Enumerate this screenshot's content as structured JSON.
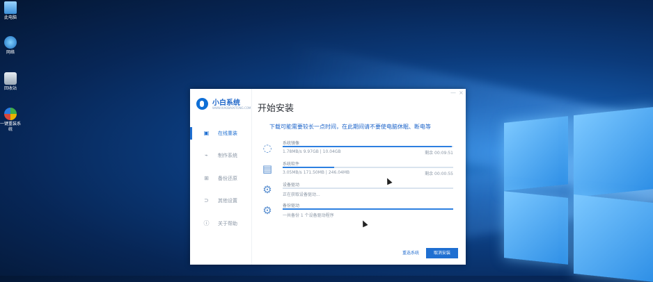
{
  "desktop_icons": [
    {
      "label": "此电脑",
      "icon": "computer-icon"
    },
    {
      "label": "网络",
      "icon": "network-icon"
    },
    {
      "label": "回收站",
      "icon": "recycle-bin-icon"
    },
    {
      "label": "一键重装系统",
      "icon": "reinstall-app-icon"
    }
  ],
  "window": {
    "brand_name": "小白系统",
    "brand_sub": "WWW.XIAOBAIXITONG.COM",
    "title": "开始安装",
    "notice": "下载可能需要较长一点时间，在此期间请不要使电脑休眠、断电等",
    "controls": {
      "minimize": "—",
      "close": "×"
    }
  },
  "sidebar": {
    "items": [
      {
        "label": "在线重装",
        "icon": "monitor-icon",
        "active": true
      },
      {
        "label": "制作系统",
        "icon": "usb-icon",
        "active": false
      },
      {
        "label": "备份还原",
        "icon": "backup-icon",
        "active": false
      },
      {
        "label": "其他设置",
        "icon": "settings-icon",
        "active": false
      },
      {
        "label": "关于帮助",
        "icon": "info-icon",
        "active": false
      }
    ]
  },
  "tasks": [
    {
      "name": "系统镜像",
      "detail": "1.78MB/s 9.97GB | 10.04GB",
      "remaining": "剩余 00:09:51",
      "progress": 0.99,
      "icon": "download-icon"
    },
    {
      "name": "系统软件",
      "detail": "3.05MB/s 171.50MB | 246.04MB",
      "remaining": "剩余 00:00:55",
      "progress": 0.3,
      "icon": "file-icon"
    },
    {
      "name": "设备驱动",
      "detail": "正在获取设备驱动...",
      "remaining": "",
      "progress": 0.0,
      "icon": "gear-icon"
    },
    {
      "name": "备份驱动",
      "detail": "一共备份 1 个设备驱动程序",
      "remaining": "",
      "progress": 1.0,
      "icon": "gear-icon"
    }
  ],
  "buttons": {
    "reselect": "重选系统",
    "cancel": "取消安装"
  },
  "colors": {
    "accent": "#1f6fd1",
    "progress": "#2c7fe0"
  }
}
